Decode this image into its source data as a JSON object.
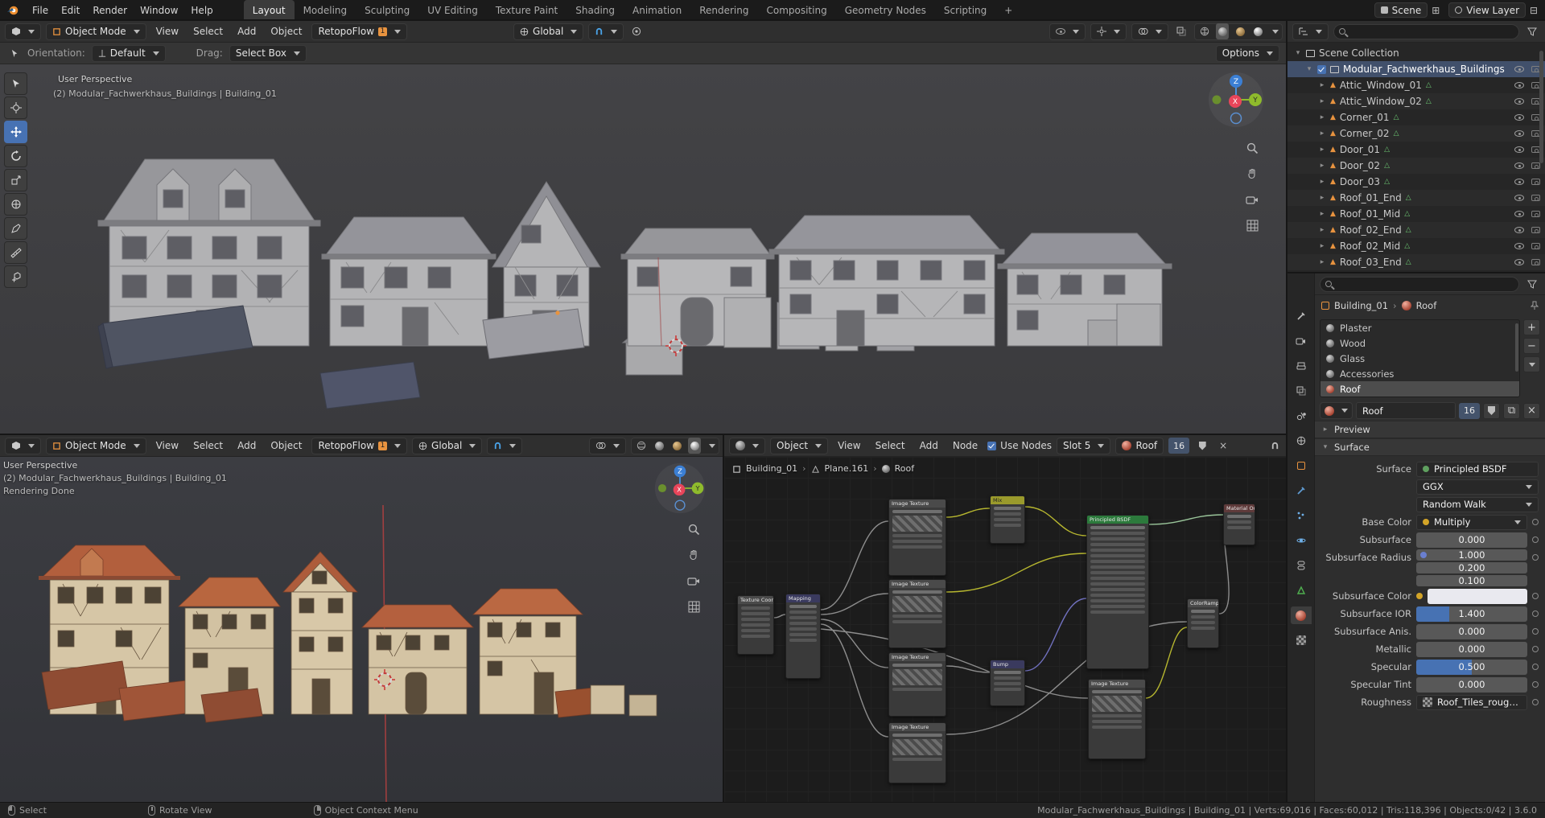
{
  "topbar": {
    "menus": [
      "File",
      "Edit",
      "Render",
      "Window",
      "Help"
    ],
    "workspaces": [
      "Layout",
      "Modeling",
      "Sculpting",
      "UV Editing",
      "Texture Paint",
      "Shading",
      "Animation",
      "Rendering",
      "Compositing",
      "Geometry Nodes",
      "Scripting"
    ],
    "scene": "Scene",
    "view_layer": "View Layer"
  },
  "viewport": {
    "mode": "Object Mode",
    "menu_view": "View",
    "menu_select": "Select",
    "menu_add": "Add",
    "menu_object": "Object",
    "retopoflow": "RetopoFlow",
    "transform_orientation": "Global",
    "orientation_label": "Orientation:",
    "orientation_value": "Default",
    "drag_label": "Drag:",
    "drag_value": "Select Box",
    "options": "Options",
    "overlay_line1": "User Perspective",
    "overlay_line2": "(2) Modular_Fachwerkhaus_Buildings | Building_01",
    "render_status": "Rendering Done"
  },
  "outliner": {
    "scene_collection": "Scene Collection",
    "collection": "Modular_Fachwerkhaus_Buildings",
    "items": [
      "Attic_Window_01",
      "Attic_Window_02",
      "Corner_01",
      "Corner_02",
      "Door_01",
      "Door_02",
      "Door_03",
      "Roof_01_End",
      "Roof_01_Mid",
      "Roof_02_End",
      "Roof_02_Mid",
      "Roof_03_End"
    ]
  },
  "properties": {
    "breadcrumb_object": "Building_01",
    "breadcrumb_material": "Roof",
    "slots": [
      "Plaster",
      "Wood",
      "Glass",
      "Accessories",
      "Roof"
    ],
    "material_name": "Roof",
    "material_users": "16",
    "preview": "Preview",
    "surface_section": "Surface",
    "surface_label": "Surface",
    "surface_value": "Principled BSDF",
    "distribution": "GGX",
    "sss_method": "Random Walk",
    "base_color_label": "Base Color",
    "base_color_value": "Multiply",
    "subsurface_label": "Subsurface",
    "subsurface_value": "0.000",
    "radius_label": "Subsurface Radius",
    "radius_x": "1.000",
    "radius_y": "0.200",
    "radius_z": "0.100",
    "sss_color_label": "Subsurface Color",
    "ior_label": "Subsurface IOR",
    "ior_value": "1.400",
    "anis_label": "Subsurface Anis.",
    "anis_value": "0.000",
    "metallic_label": "Metallic",
    "metallic_value": "0.000",
    "specular_label": "Specular",
    "specular_value": "0.500",
    "spec_tint_label": "Specular Tint",
    "spec_tint_value": "0.000",
    "roughness_label": "Roughness",
    "roughness_value": "Roof_Tiles_roughness...."
  },
  "shader": {
    "mode": "Object",
    "menu_view": "View",
    "menu_select": "Select",
    "menu_add": "Add",
    "menu_node": "Node",
    "use_nodes": "Use Nodes",
    "slot": "Slot 5",
    "material": "Roof",
    "users": "16",
    "bc_object": "Building_01",
    "bc_mesh": "Plane.161",
    "bc_material": "Roof",
    "nodes": [
      "Texture Coordinate",
      "Mapping",
      "Image Texture",
      "Image Texture",
      "Image Texture",
      "Image Texture",
      "Mix",
      "Bump",
      "Principled BSDF",
      "ColorRamp",
      "Material Output",
      "Image Texture"
    ]
  },
  "statusbar": {
    "hint_select": "Select",
    "hint_rotate": "Rotate View",
    "hint_context": "Object Context Menu",
    "stats": "Modular_Fachwerkhaus_Buildings | Building_01 | Verts:69,016 | Faces:60,012 | Tris:118,396 | Objects:0/42 | 3.6.0"
  }
}
